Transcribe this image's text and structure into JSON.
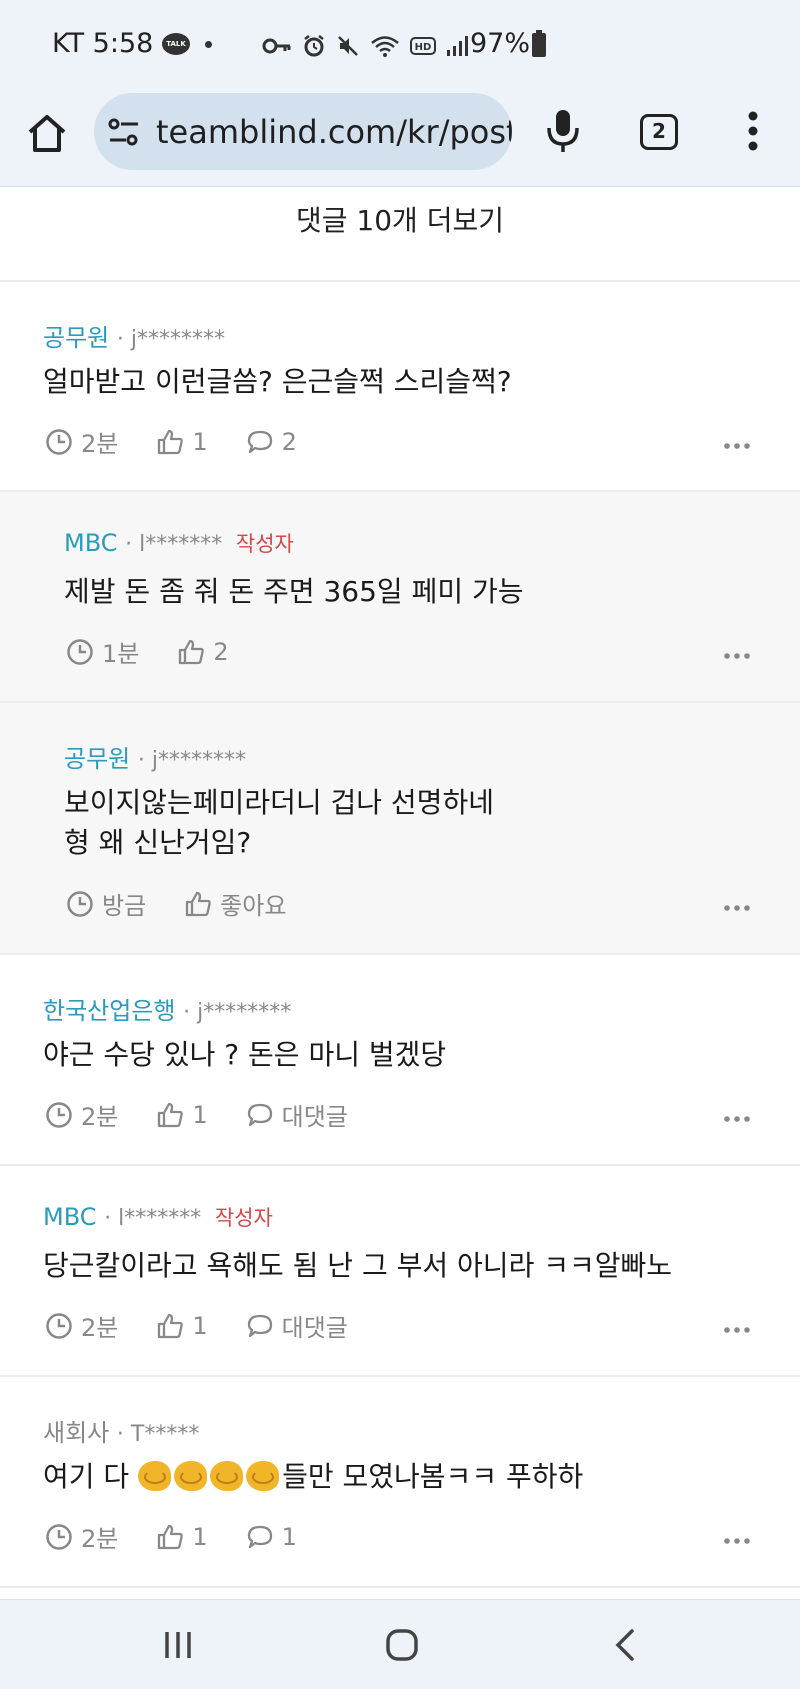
{
  "status_bar": {
    "carrier_time": "KT 5:58",
    "talk_badge": "TALK",
    "battery": "97%"
  },
  "browser": {
    "url": "teamblind.com/kr/post",
    "tab_count": "2"
  },
  "more_comments": "댓글 10개 더보기",
  "comments": [
    {
      "company": "공무원",
      "user": "· j********",
      "author_tag": "",
      "body": [
        "얼마받고 이런글씀? 은근슬쩍 스리슬쩍?"
      ],
      "time": "2분",
      "likes": "1",
      "replies": "2",
      "is_reply": false
    },
    {
      "company": "MBC",
      "user": "· l*******",
      "author_tag": "작성자",
      "body": [
        "제발 돈 좀 줘 돈 주면 365일 페미 가능"
      ],
      "time": "1분",
      "likes": "2",
      "replies": "",
      "is_reply": true
    },
    {
      "company": "공무원",
      "user": "· j********",
      "author_tag": "",
      "body": [
        "보이지않는페미라더니 겁나 선명하네",
        "형 왜 신난거임?"
      ],
      "time": "방금",
      "likes": "좋아요",
      "replies": "",
      "is_reply": true
    },
    {
      "company": "한국산업은행",
      "user": "· j********",
      "author_tag": "",
      "body": [
        "야근 수당 있나 ? 돈은 마니 벌겠당"
      ],
      "time": "2분",
      "likes": "1",
      "replies": "대댓글",
      "is_reply": false
    },
    {
      "company": "MBC",
      "user": "· l*******",
      "author_tag": "작성자",
      "body": [
        "당근칼이라고 욕해도 됨 난 그 부서 아니라 ㅋㅋ알빠노"
      ],
      "time": "2분",
      "likes": "1",
      "replies": "대댓글",
      "is_reply": false
    },
    {
      "company": "새회사",
      "user": "· T*****",
      "author_tag": "",
      "body_prefix": "여기 다 ",
      "body_suffix": "들만 모였나봄ㅋㅋ 푸하하",
      "time": "2분",
      "likes": "1",
      "replies": "1",
      "is_reply": false
    }
  ],
  "icons": {
    "clock": "clock-icon",
    "like": "thumbs-up-icon",
    "reply": "speech-bubble-icon",
    "more": "more-dots-icon",
    "emoji": "pinching-hand-emoji"
  },
  "colors": {
    "company": "#2a9bbd",
    "author_tag": "#d14a4a",
    "reply_background": "#f7f7f7",
    "chrome_background": "#eef2f9"
  }
}
